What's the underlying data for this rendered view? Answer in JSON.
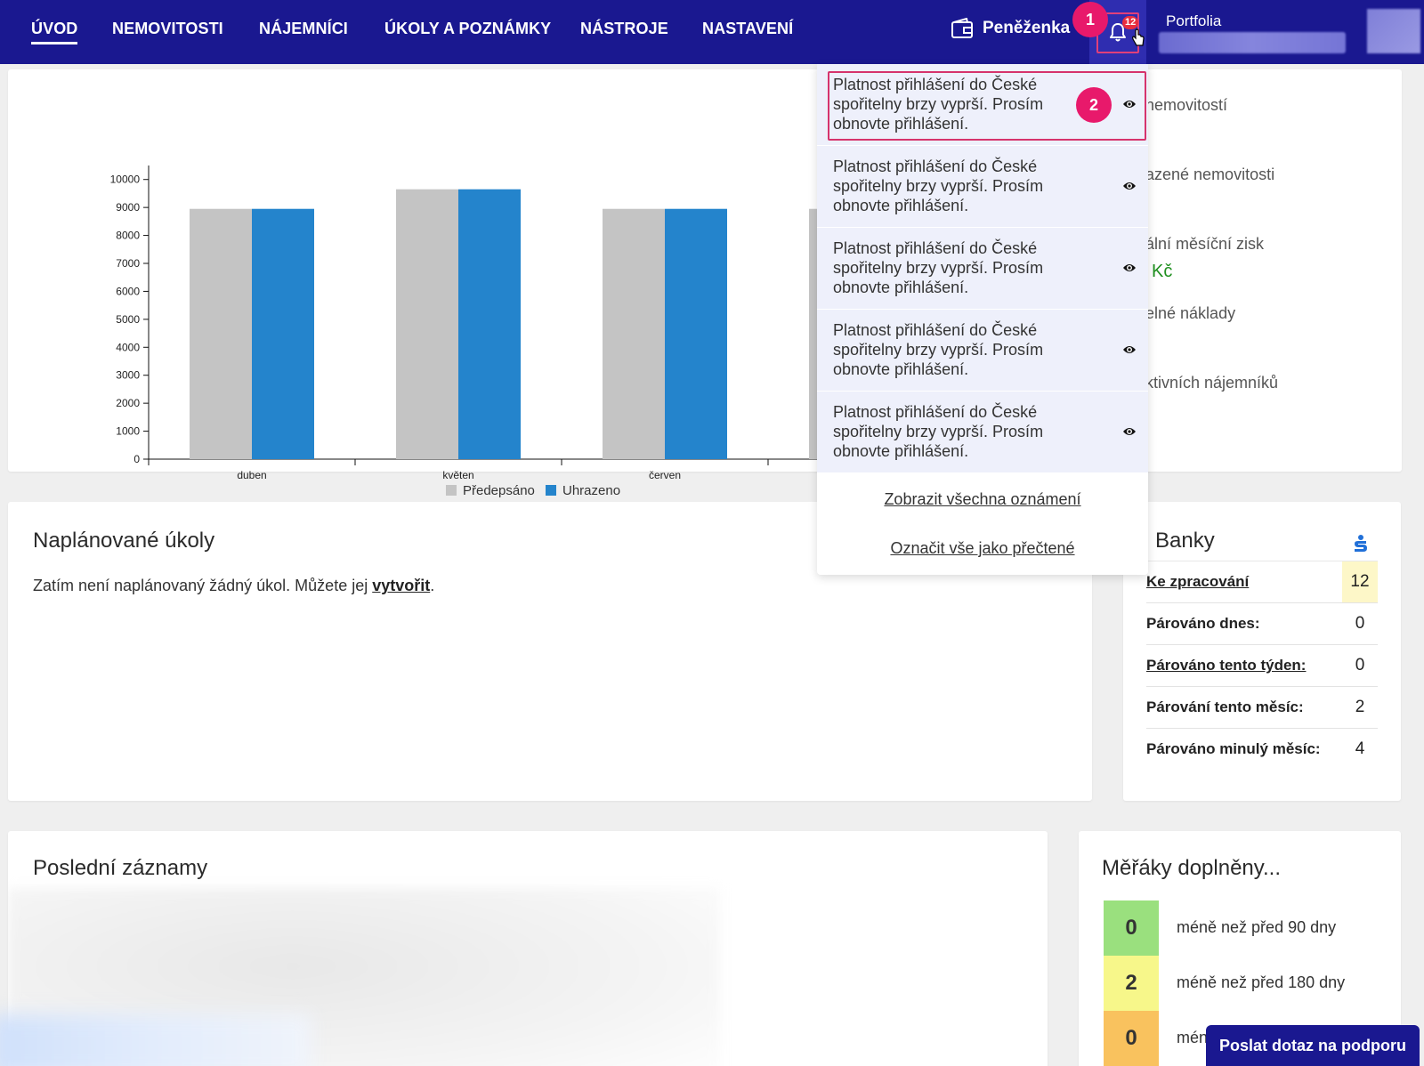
{
  "nav": {
    "items": [
      "ÚVOD",
      "NEMOVITOSTI",
      "NÁJEMNÍCI",
      "ÚKOLY A POZNÁMKY",
      "NÁSTROJE",
      "NASTAVENÍ"
    ],
    "wallet_label": "Peněženka",
    "notification_count": "12",
    "portfolio_label": "Portfolia"
  },
  "steps": {
    "one": "1",
    "two": "2"
  },
  "chart_data": {
    "type": "bar",
    "categories": [
      "duben",
      "květen",
      "červen",
      ""
    ],
    "series": [
      {
        "name": "Předepsáno",
        "color": "#c4c4c4",
        "values": [
          8950,
          9650,
          8950,
          8950
        ]
      },
      {
        "name": "Uhrazeno",
        "color": "#2484cc",
        "values": [
          8950,
          9650,
          8950,
          null
        ]
      }
    ],
    "yticks": [
      0,
      1000,
      2000,
      3000,
      4000,
      5000,
      6000,
      7000,
      8000,
      9000,
      10000
    ],
    "ylim": [
      0,
      10500
    ],
    "legend": "bottom-center"
  },
  "stats": {
    "l1": "nemovitostí",
    "l2": "azené nemovitosti",
    "l3": "ální měsíční zisk",
    "v3": "Kč",
    "l4": "elné náklady",
    "l5": "ktivních nájemníků"
  },
  "tasks": {
    "title": "Naplánované úkoly",
    "text": "Zatím není naplánovaný žádný úkol. Můžete jej ",
    "link": "vytvořit",
    "end": "."
  },
  "banks": {
    "title": "Banky",
    "rows": [
      {
        "label": "Ke zpracování",
        "value": "12"
      },
      {
        "label": "Párováno dnes:",
        "value": "0"
      },
      {
        "label": "Párováno tento týden:",
        "value": "0"
      },
      {
        "label": "Párování tento měsíc:",
        "value": "2"
      },
      {
        "label": "Párováno minulý měsíc:",
        "value": "4"
      }
    ]
  },
  "records": {
    "title": "Poslední záznamy"
  },
  "gauges": {
    "title": "Měřáky doplněny...",
    "rows": [
      {
        "value": "0",
        "label": "méně než před 90 dny",
        "color": "#9ae07e"
      },
      {
        "value": "2",
        "label": "méně než před 180 dny",
        "color": "#f7f78a"
      },
      {
        "value": "0",
        "label": "mén",
        "color": "#f9c25e"
      }
    ]
  },
  "notifications": {
    "items": [
      "Platnost přihlášení do České spořitelny brzy vyprší. Prosím obnovte přihlášení.",
      "Platnost přihlášení do České spořitelny brzy vyprší. Prosím obnovte přihlášení.",
      "Platnost přihlášení do České spořitelny brzy vyprší. Prosím obnovte přihlášení.",
      "Platnost přihlášení do České spořitelny brzy vyprší. Prosím obnovte přihlášení.",
      "Platnost přihlášení do České spořitelny brzy vyprší. Prosím obnovte přihlášení."
    ],
    "show_all": "Zobrazit všechna oznámení",
    "mark_read": "Označit vše jako přečtené"
  },
  "support": {
    "label": "Poslat dotaz na podporu"
  }
}
